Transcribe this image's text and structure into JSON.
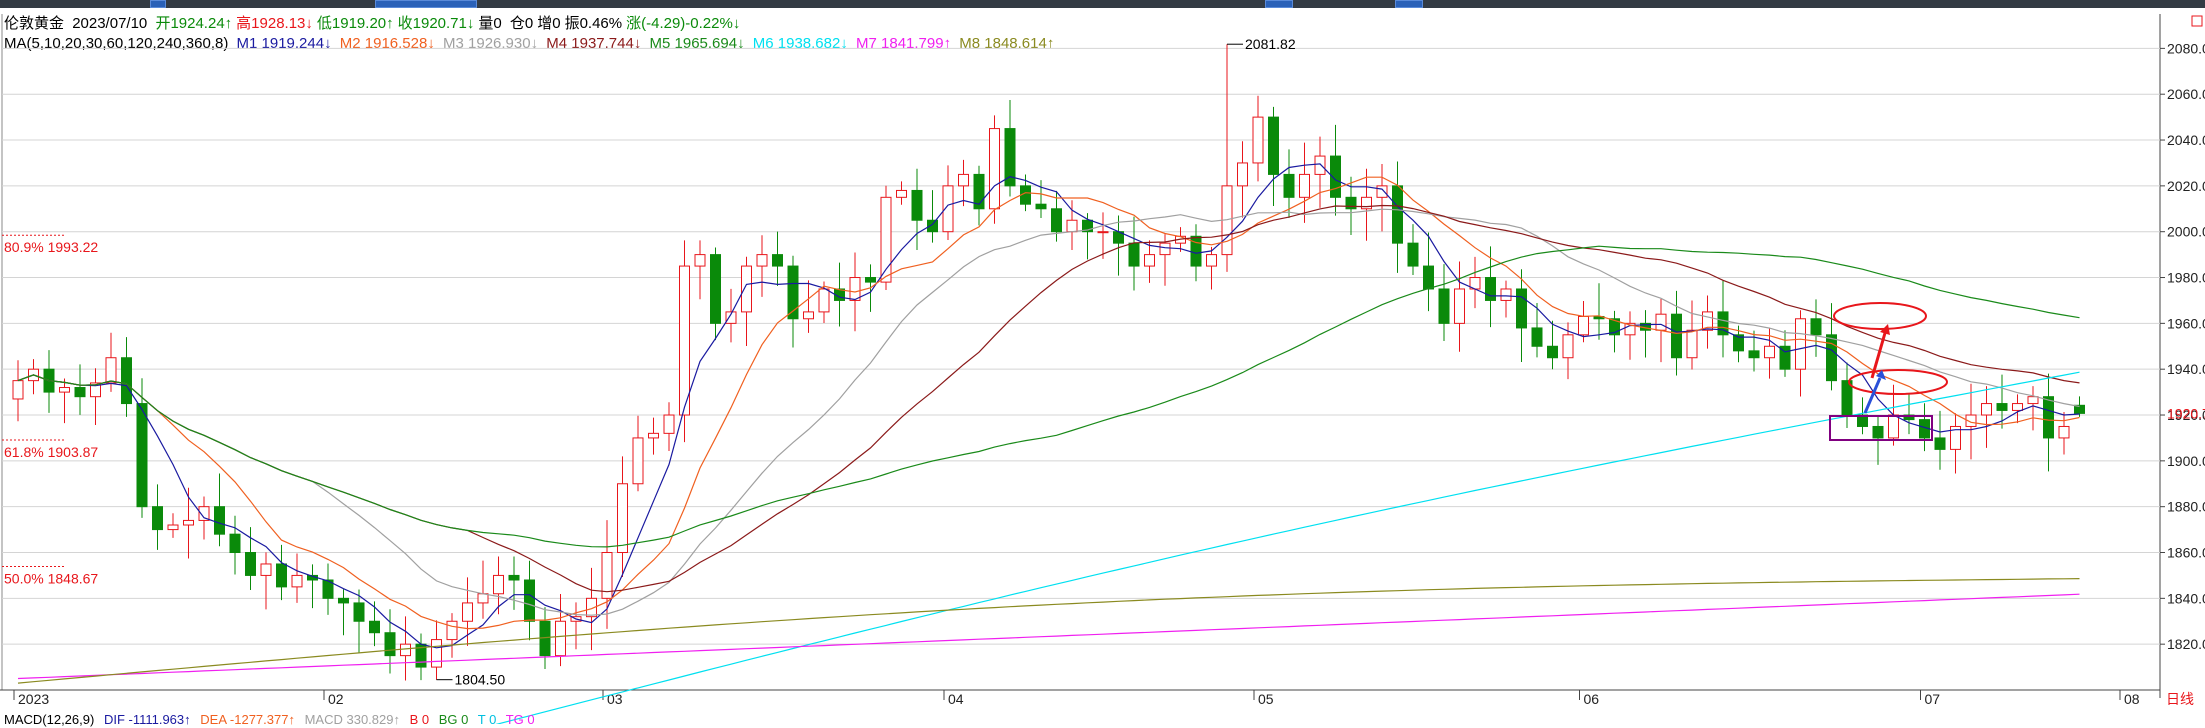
{
  "toolbar": {},
  "header": {
    "symbol": "伦敦黄金",
    "date": "2023/07/10",
    "open": "开1924.24↑",
    "high": "高1928.13↓",
    "low": "低1919.20↑",
    "close": "收1920.71↓",
    "volume": "量0",
    "position": "仓0",
    "increase": "增0",
    "amplitude": "振0.46%",
    "change": "涨(-4.29)-0.22%↓"
  },
  "ma_legend": {
    "label": "MA(5,10,20,30,60,120,240,360,8)",
    "items": [
      {
        "text": "M1 1919.244↓",
        "color": "#1a1aa0"
      },
      {
        "text": "M2 1916.528↓",
        "color": "#f06020"
      },
      {
        "text": "M3 1926.930↓",
        "color": "#a0a0a0"
      },
      {
        "text": "M4 1937.744↓",
        "color": "#8b1a1a"
      },
      {
        "text": "M5 1965.694↓",
        "color": "#1a8a1a"
      },
      {
        "text": "M6 1938.682↓",
        "color": "#00e0f0"
      },
      {
        "text": "M7 1841.799↑",
        "color": "#f020f0"
      },
      {
        "text": "M8 1848.614↑",
        "color": "#8a8a20"
      }
    ]
  },
  "macd_legend": {
    "items": [
      {
        "text": "MACD(12,26,9)",
        "color": "#000000"
      },
      {
        "text": "DIF -1111.963↑",
        "color": "#1a1aa0"
      },
      {
        "text": "DEA -1277.377↑",
        "color": "#f06020"
      },
      {
        "text": "MACD 330.829↑",
        "color": "#a0a0a0"
      },
      {
        "text": "B 0",
        "color": "#e8161b"
      },
      {
        "text": "BG 0",
        "color": "#1a8a1a"
      },
      {
        "text": "T 0",
        "color": "#00c0e0"
      },
      {
        "text": "TG 0",
        "color": "#f020f0"
      }
    ]
  },
  "chart_data": {
    "type": "candlestick",
    "ylim": [
      1800,
      2095
    ],
    "y_ticks": [
      "1820.00",
      "1840.00",
      "1860.00",
      "1880.00",
      "1900.00",
      "1920.00",
      "1940.00",
      "1960.00",
      "1980.00",
      "2000.00",
      "2020.00",
      "2040.00",
      "2060.00",
      "2080.00"
    ],
    "last_price_label": "1920.71",
    "last_price": 1920.71,
    "x_labels": [
      "2023",
      "02",
      "03",
      "04",
      "05",
      "06",
      "07",
      "08"
    ],
    "x_label_dates": [
      0,
      20,
      38,
      60,
      80,
      101,
      123,
      147
    ],
    "corner_label": "日线",
    "fib_levels": [
      {
        "text": "80.9% 1993.22",
        "value": 1993.22
      },
      {
        "text": "61.8% 1903.87",
        "value": 1903.87
      },
      {
        "text": "50.0% 1848.67",
        "value": 1848.67
      }
    ],
    "annotations": [
      {
        "text": "2081.82",
        "value": 2081.82,
        "index": 78
      },
      {
        "text": "1804.50",
        "value": 1804.5,
        "index": 27
      }
    ],
    "ma_series_colors": [
      "#1a1aa0",
      "#f06020",
      "#a0a0a0",
      "#8b1a1a",
      "#1a8a1a",
      "#00e0f0",
      "#f020f0",
      "#8a8a20"
    ],
    "closes": [
      1935,
      1940,
      1930,
      1932,
      1928,
      1934,
      1945,
      1925,
      1880,
      1870,
      1872,
      1874,
      1880,
      1868,
      1860,
      1850,
      1855,
      1845,
      1850,
      1848,
      1840,
      1838,
      1830,
      1825,
      1815,
      1820,
      1810,
      1822,
      1830,
      1838,
      1842,
      1850,
      1848,
      1830,
      1815,
      1830,
      1832,
      1840,
      1860,
      1890,
      1910,
      1912,
      1920,
      1985,
      1990,
      1960,
      1965,
      1985,
      1990,
      1985,
      1962,
      1965,
      1975,
      1970,
      1980,
      1978,
      2015,
      2018,
      2005,
      2000,
      2020,
      2025,
      2010,
      2045,
      2020,
      2012,
      2010,
      2000,
      2005,
      2000,
      2000,
      1995,
      1985,
      1990,
      1995,
      1998,
      1985,
      1990,
      2020,
      2030,
      2050,
      2025,
      2015,
      2025,
      2033,
      2015,
      2010,
      2015,
      2020,
      1995,
      1985,
      1975,
      1960,
      1975,
      1980,
      1970,
      1975,
      1958,
      1950,
      1945,
      1955,
      1963,
      1962,
      1955,
      1960,
      1957,
      1964,
      1945,
      1957,
      1965,
      1955,
      1948,
      1945,
      1950,
      1940,
      1962,
      1955,
      1935,
      1920,
      1915,
      1910,
      1920,
      1918,
      1910,
      1905,
      1915,
      1920,
      1925,
      1922,
      1925,
      1928,
      1910,
      1915,
      1924.24
    ],
    "final_candle": {
      "open": 1924.24,
      "high": 1928.13,
      "low": 1919.2,
      "close": 1920.71
    }
  }
}
